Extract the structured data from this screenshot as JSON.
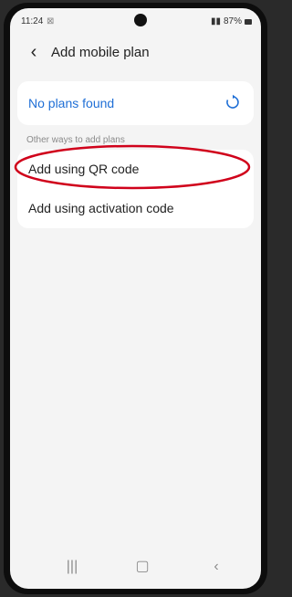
{
  "status": {
    "time": "11:24",
    "extra": "⊠",
    "battery": "87%"
  },
  "topbar": {
    "title": "Add mobile plan"
  },
  "plans": {
    "empty_text": "No plans found"
  },
  "other": {
    "section_label": "Other ways to add plans",
    "items": [
      {
        "label": "Add using QR code"
      },
      {
        "label": "Add using activation code"
      }
    ]
  },
  "icons": {
    "back": "back-icon",
    "refresh": "refresh-icon",
    "nav_recent": "recent-apps-icon",
    "nav_home": "home-icon",
    "nav_back": "nav-back-icon"
  },
  "colors": {
    "accent": "#1f6fd6",
    "highlight": "#d0021b"
  }
}
